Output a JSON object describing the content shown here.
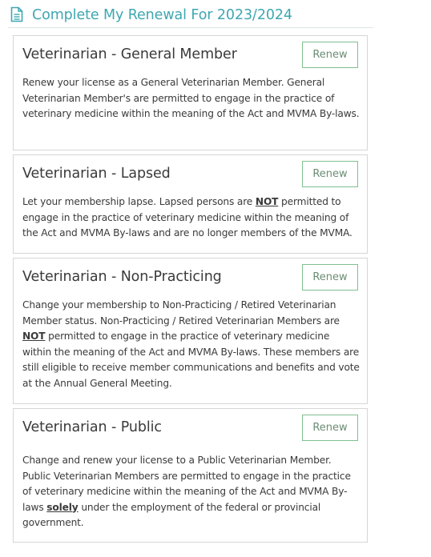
{
  "header": {
    "icon": "document-icon",
    "title": "Complete My Renewal For 2023/2024",
    "accent_color": "#3fa7b1"
  },
  "cards": [
    {
      "title": "Veterinarian - General Member",
      "button_label": "Renew",
      "description": "Renew your license as a General Veterinarian Member. General Veterinarian Member's are permitted to engage in the practice of veterinary medicine within the meaning of the Act and MVMA By-laws."
    },
    {
      "title": "Veterinarian - Lapsed",
      "button_label": "Renew",
      "description_parts": [
        "Let your membership lapse. Lapsed persons are ",
        "NOT",
        " permitted to engage in the practice of veterinary medicine within the meaning of the Act and MVMA By-laws and are no longer members of the MVMA."
      ]
    },
    {
      "title": "Veterinarian - Non-Practicing",
      "button_label": "Renew",
      "description_parts": [
        "Change your membership to Non-Practicing / Retired Veterinarian Member status. Non-Practicing / Retired Veterinarian Members are ",
        "NOT",
        " permitted to engage in the practice of veterinary medicine within the meaning of the Act and MVMA By-laws. These members are still eligible to receive member communications and benefits and vote at the Annual General Meeting."
      ]
    },
    {
      "title": "Veterinarian - Public",
      "button_label": "Renew",
      "description_parts": [
        "Change and renew your license to a Public Veterinarian Member. Public Veterinarian Members are permitted to engage in the practice of veterinary medicine within the meaning of the Act and MVMA By-laws ",
        "solely",
        " under the employment of the federal or provincial government."
      ]
    }
  ],
  "colors": {
    "button_border": "#7fc08f",
    "card_border": "#d6d6d6"
  }
}
